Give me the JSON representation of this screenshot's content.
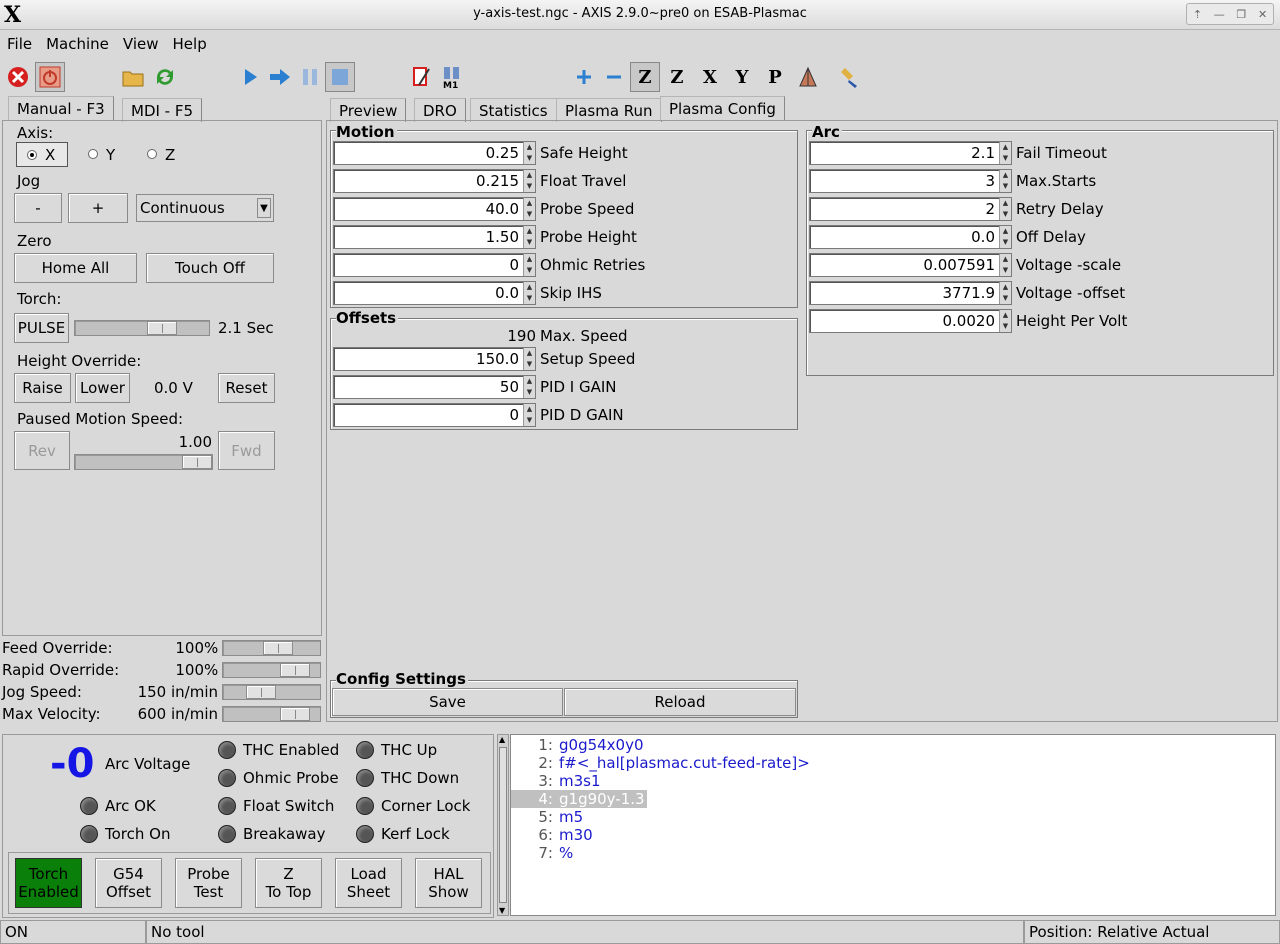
{
  "window": {
    "title": "y-axis-test.ngc - AXIS 2.9.0~pre0 on ESAB-Plasmac",
    "logo": "X"
  },
  "menu": [
    "File",
    "Machine",
    "View",
    "Help"
  ],
  "toolbar_icons": [
    "estop-icon",
    "power-icon",
    "open-file-icon",
    "reload-icon",
    "run-icon",
    "step-icon",
    "pause-icon",
    "stop-icon",
    "skip-icon",
    "m1-icon",
    "zoom-in-icon",
    "zoom-out-icon",
    "view-z-icon",
    "view-z2-icon",
    "view-x-icon",
    "view-y-icon",
    "view-p-icon",
    "toggle-view-icon",
    "clear-plot-icon"
  ],
  "left_tabs": [
    "Manual - F3",
    "MDI - F5"
  ],
  "manual": {
    "axis_label": "Axis:",
    "axes": [
      "X",
      "Y",
      "Z"
    ],
    "selected_axis": "X",
    "jog_label": "Jog",
    "jog_minus": "-",
    "jog_plus": "+",
    "jog_mode": "Continuous",
    "zero_label": "Zero",
    "home_all": "Home All",
    "touch_off": "Touch Off",
    "torch_label": "Torch:",
    "pulse": "PULSE",
    "pulse_time": "2.1 Sec",
    "height_override_label": "Height Override:",
    "raise": "Raise",
    "lower": "Lower",
    "override_value": "0.0 V",
    "reset": "Reset",
    "paused_motion_label": "Paused Motion Speed:",
    "rev": "Rev",
    "fwd": "Fwd",
    "paused_speed": "1.00"
  },
  "overrides": [
    {
      "label": "Feed Override:",
      "value": "100",
      "unit": "%",
      "level": 0.6
    },
    {
      "label": "Rapid Override:",
      "value": "100",
      "unit": "%",
      "level": 0.85
    },
    {
      "label": "Jog Speed:",
      "value": "150 in/min",
      "unit": "",
      "level": 0.35
    },
    {
      "label": "Max Velocity:",
      "value": "600 in/min",
      "unit": "",
      "level": 0.85
    }
  ],
  "right_tabs": [
    "Preview",
    "DRO",
    "Statistics",
    "Plasma Run",
    "Plasma Config"
  ],
  "active_right_tab": "Plasma Config",
  "motion": {
    "title": "Motion",
    "fields": [
      {
        "value": "0.25",
        "label": "Safe Height"
      },
      {
        "value": "0.215",
        "label": "Float Travel"
      },
      {
        "value": "40.0",
        "label": "Probe Speed"
      },
      {
        "value": "1.50",
        "label": "Probe Height"
      },
      {
        "value": "0",
        "label": "Ohmic Retries"
      },
      {
        "value": "0.0",
        "label": "Skip IHS"
      }
    ]
  },
  "offsets": {
    "title": "Offsets",
    "max_speed_value": "190",
    "max_speed_label": "Max. Speed",
    "fields": [
      {
        "value": "150.0",
        "label": "Setup Speed"
      },
      {
        "value": "50",
        "label": "PID I GAIN"
      },
      {
        "value": "0",
        "label": "PID D GAIN"
      }
    ]
  },
  "arc": {
    "title": "Arc",
    "fields": [
      {
        "value": "2.1",
        "label": "Fail Timeout"
      },
      {
        "value": "3",
        "label": "Max.Starts"
      },
      {
        "value": "2",
        "label": "Retry Delay"
      },
      {
        "value": "0.0",
        "label": "Off Delay"
      },
      {
        "value": "0.007591",
        "label": "Voltage -scale"
      },
      {
        "value": "3771.9",
        "label": "Voltage -offset"
      },
      {
        "value": "0.0020",
        "label": "Height Per Volt"
      }
    ]
  },
  "config_settings": {
    "title": "Config Settings",
    "save": "Save",
    "reload": "Reload"
  },
  "plasma_status": {
    "arc_voltage_value": "-0",
    "arc_voltage_label": "Arc Voltage",
    "leds": [
      "Arc OK",
      "Torch On",
      "THC Enabled",
      "Ohmic Probe",
      "Float Switch",
      "Breakaway",
      "THC Up",
      "THC Down",
      "Corner Lock",
      "Kerf Lock"
    ],
    "buttons": [
      {
        "line1": "Torch",
        "line2": "Enabled"
      },
      {
        "line1": "G54",
        "line2": "Offset"
      },
      {
        "line1": "Probe",
        "line2": "Test"
      },
      {
        "line1": "Z",
        "line2": "To Top"
      },
      {
        "line1": "Load",
        "line2": "Sheet"
      },
      {
        "line1": "HAL",
        "line2": "Show"
      }
    ]
  },
  "gcode": [
    {
      "n": "1:",
      "code": "g0g54x0y0"
    },
    {
      "n": "2:",
      "code": "f#<_hal[plasmac.cut-feed-rate]>"
    },
    {
      "n": "3:",
      "code": "m3s1"
    },
    {
      "n": "4:",
      "code": "g1g90y-1.3"
    },
    {
      "n": "5:",
      "code": "m5"
    },
    {
      "n": "6:",
      "code": "m30"
    },
    {
      "n": "7:",
      "code": "%"
    }
  ],
  "highlighted_line": 3,
  "status": {
    "machine": "ON",
    "tool": "No tool",
    "position": "Position: Relative Actual"
  },
  "colors": {
    "torch_enabled": "#0a7f0a",
    "arc_voltage": "#1515e6",
    "gcode": "#1a1acc",
    "estop": "#d62020"
  }
}
